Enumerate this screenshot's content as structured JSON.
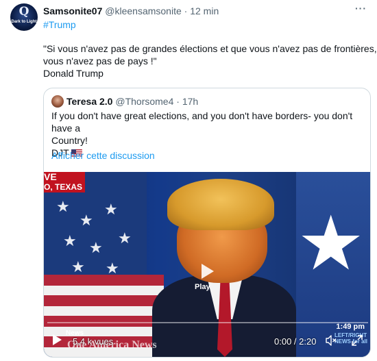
{
  "tweet": {
    "author_name": "Samsonite07",
    "author_handle": "@kleensamsonite",
    "separator": " · ",
    "time": "12 min",
    "more_label": "···",
    "avatar_text": "Dark to Light",
    "avatar_letter": "Q",
    "hashtag": "#Trump",
    "text_lines": [
      "\"Si vous n'avez pas de grandes élections et que vous n'avez pas de frontières,",
      "vous n'avez pas de pays !\"",
      "Donald Trump"
    ]
  },
  "quoted": {
    "author_name": "Teresa 2.0",
    "author_handle": "@Thorsome4",
    "separator": " · ",
    "time": "17h",
    "text_line1": "If you don't have great elections, and you don't have borders- you don't have a",
    "text_line2": "Country!",
    "text_line3": "DJT",
    "flag_icon": "us-flag-emoji",
    "show_thread_link": "Afficher cette discussion"
  },
  "video": {
    "live_badge": "VE",
    "location_caption": "O, TEXAS",
    "play_label": "Play",
    "clock_overlay": "1:49 pm",
    "news_caption": "News",
    "network_caption": "One America News",
    "tag_line1": "LEFT/RIGHT",
    "tag_line2": "NEWS for all",
    "views": "5,4 k vues",
    "timecode": "0:00 / 2:20",
    "progress": 0,
    "icons": {
      "play": "play-icon",
      "mute": "speaker-muted-icon",
      "fullscreen": "fullscreen-icon"
    }
  },
  "colors": {
    "link": "#1d9bf0",
    "secondary_text": "#536471",
    "border": "#cfd9de"
  }
}
